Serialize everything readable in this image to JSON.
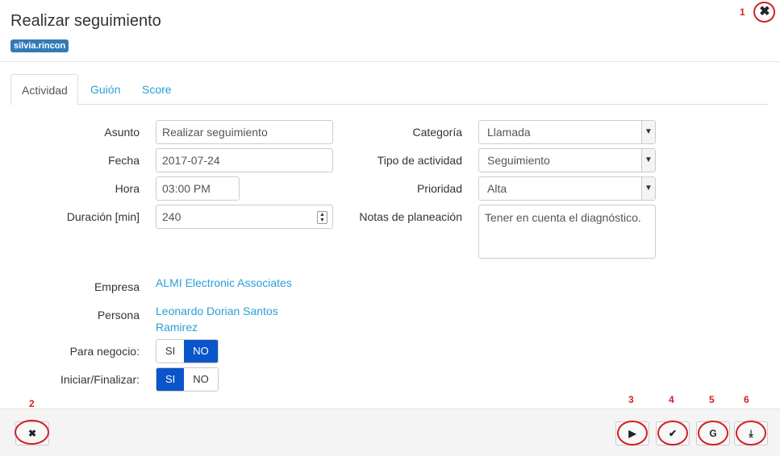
{
  "modal": {
    "title": "Realizar seguimiento",
    "user": "silvia.rincon",
    "close_glyph": "✖",
    "close_icon": "close-icon"
  },
  "annotations": [
    "1",
    "2",
    "3",
    "4",
    "5",
    "6"
  ],
  "annotation_color": "#d42020",
  "tabs": [
    {
      "label": "Actividad",
      "active": true
    },
    {
      "label": "Guión",
      "active": false
    },
    {
      "label": "Score",
      "active": false
    }
  ],
  "form": {
    "asunto": {
      "label": "Asunto",
      "value": "Realizar seguimiento"
    },
    "fecha": {
      "label": "Fecha",
      "value": "2017-07-24"
    },
    "hora": {
      "label": "Hora",
      "value": "03:00 PM"
    },
    "duracion": {
      "label": "Duración [min]",
      "value": "240"
    },
    "categoria": {
      "label": "Categoría",
      "value": "Llamada"
    },
    "tipo": {
      "label": "Tipo de actividad",
      "value": "Seguimiento"
    },
    "prioridad": {
      "label": "Prioridad",
      "value": "Alta"
    },
    "notas": {
      "label": "Notas de planeación",
      "value": "Tener en cuenta el diagnóstico."
    },
    "empresa": {
      "label": "Empresa",
      "value": "ALMI Electronic Associates"
    },
    "persona": {
      "label": "Persona",
      "line1": "Leonardo Dorian Santos",
      "line2": "Ramirez"
    },
    "para_negocio": {
      "label": "Para negocio:",
      "yes": "SI",
      "no": "NO",
      "selected": "NO"
    },
    "iniciar": {
      "label": "Iniciar/Finalizar:",
      "yes": "SI",
      "no": "NO",
      "selected": "SI"
    }
  },
  "footer": {
    "cancel_glyph": "✖",
    "cancel_icon": "close-icon",
    "play_glyph": "▶",
    "play_icon": "play-icon",
    "check_glyph": "✔",
    "check_icon": "check-icon",
    "google_glyph": "G",
    "google_icon": "google-icon",
    "download_glyph": "⤓",
    "download_icon": "download-icon"
  },
  "colors": {
    "accent": "#2a9fd6",
    "toggle_on": "#0a55c9",
    "badge": "#337ab7"
  }
}
